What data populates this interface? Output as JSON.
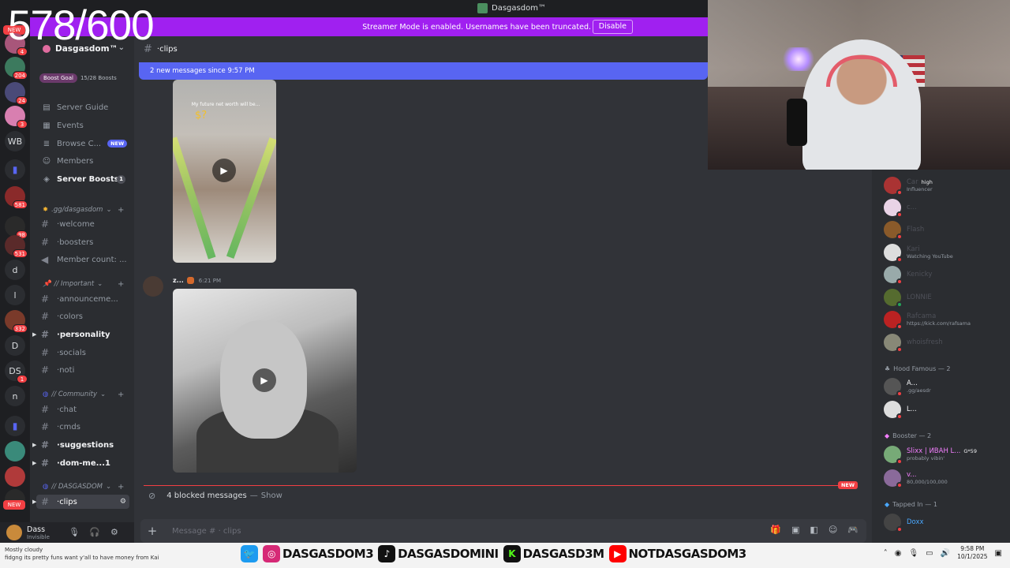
{
  "window": {
    "title": "Dasgasdom™"
  },
  "overlay_count": "578/600",
  "banner": {
    "message": "Streamer Mode is enabled. Usernames have been truncated.",
    "button": "Disable"
  },
  "rail": {
    "items": [
      {
        "label": "",
        "badge": "4"
      },
      {
        "label": "",
        "badge": "204"
      },
      {
        "label": "",
        "badge": "24"
      },
      {
        "label": "",
        "badge": "3"
      },
      {
        "label": "WB",
        "badge": ""
      },
      {
        "label": "",
        "badge": "581"
      },
      {
        "label": "",
        "badge": "98"
      },
      {
        "label": "",
        "badge": "531"
      },
      {
        "label": "d",
        "badge": ""
      },
      {
        "label": "l",
        "badge": ""
      },
      {
        "label": "",
        "badge": "332"
      },
      {
        "label": "D",
        "badge": ""
      },
      {
        "label": "DS",
        "badge": "1"
      },
      {
        "label": "n",
        "badge": ""
      }
    ],
    "new_top": "NEW",
    "new_bottom": "NEW"
  },
  "guild": {
    "name": "Dasgasdom™",
    "boost_goal": "Boost Goal",
    "boost_count": "15/28 Boosts",
    "nav": [
      {
        "label": "Server Guide",
        "icon": "book-icon"
      },
      {
        "label": "Events",
        "icon": "calendar-icon"
      },
      {
        "label": "Browse C...",
        "icon": "browse-icon",
        "pill": "NEW"
      },
      {
        "label": "Members",
        "icon": "members-icon"
      },
      {
        "label": "Server Boosts",
        "icon": "boost-icon",
        "count": "1"
      }
    ],
    "cat1": {
      "label": ".gg/dasgasdom",
      "channels": [
        "welcome",
        "boosters",
        "Member count: ..."
      ]
    },
    "cat2": {
      "label": "// Important",
      "channels": [
        "announceme...",
        "colors",
        "personality",
        "socials",
        "noti"
      ]
    },
    "cat3": {
      "label": "// Community",
      "channels": [
        "chat",
        "cmds",
        "suggestions",
        "dom-me..."
      ],
      "mention": "1"
    },
    "cat4": {
      "label": "// DASGASDOM",
      "selected": "clips"
    }
  },
  "user": {
    "name": "Dass",
    "status": "Invisible"
  },
  "channel": {
    "name": "clips",
    "new_messages": "2 new messages since 9:57 PM",
    "video1_caption": "My future net worth will be...",
    "msg_author": "z...",
    "msg_time": "6:21 PM",
    "new_label": "NEW",
    "blocked": "4 blocked messages",
    "blocked_sep": "—",
    "show": "Show",
    "composer_placeholder": "Message # · clips"
  },
  "members": {
    "list1": [
      {
        "name": "Car",
        "sub": "Influencer",
        "tag": "high"
      },
      {
        "name": "c...",
        "sub": ""
      },
      {
        "name": "Flash",
        "sub": ""
      },
      {
        "name": "Kari",
        "sub": "Watching YouTube"
      },
      {
        "name": "Kenicky",
        "sub": ""
      },
      {
        "name": "LONNIE",
        "sub": ""
      },
      {
        "name": "Rafcama",
        "sub": "https://kick.com/rafsama"
      },
      {
        "name": "whoisfresh",
        "sub": ""
      }
    ],
    "role_hood": "Hood Famous — 2",
    "hood": [
      {
        "name": "A...",
        "sub": ".gg/aesdr"
      },
      {
        "name": "L...",
        "sub": ""
      }
    ],
    "role_booster": "Booster — 2",
    "booster": [
      {
        "name": "Slixx | ИВАН L...",
        "sub": "probably vibin'",
        "tag": "G*59"
      },
      {
        "name": "v...",
        "sub": "80,000/100,000"
      }
    ],
    "role_tapped": "Tapped In — 1",
    "tapped": [
      {
        "name": "Doxx",
        "sub": ""
      }
    ]
  },
  "stream": {
    "chat_line1": "Mostly cloudy",
    "chat_line2": "fidgng its pretty funs want y'all to have money from Kai",
    "socials": [
      "DASGASDOM3",
      "DASGASDOMINI",
      "DASGASD3M",
      "NOTDASGASDOM3"
    ],
    "time": "9:58 PM",
    "date": "10/1/2025"
  }
}
